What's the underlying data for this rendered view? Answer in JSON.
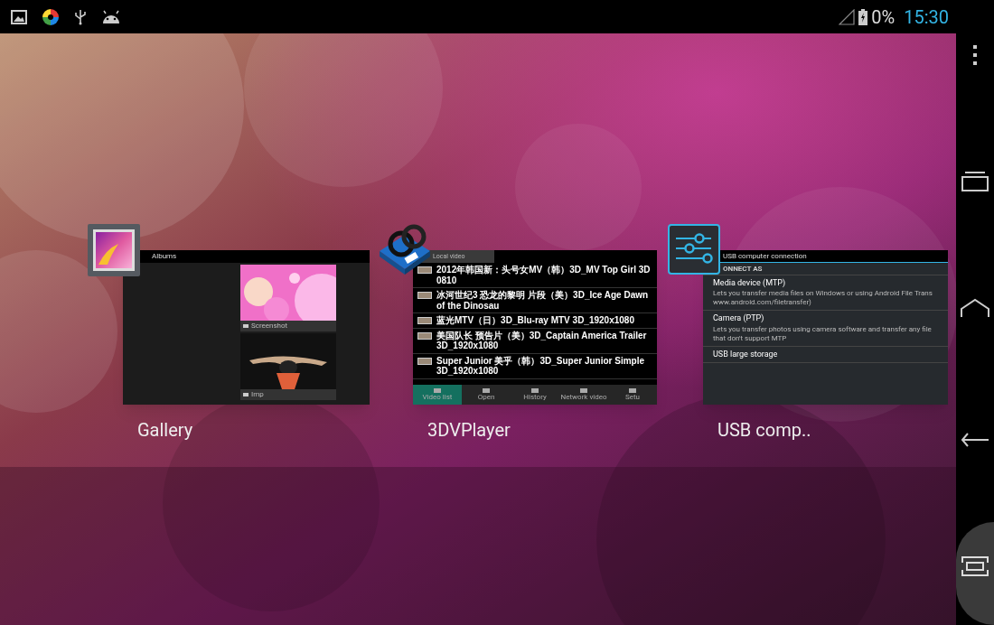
{
  "status_bar": {
    "battery": "0%",
    "time": "15:30"
  },
  "recent_apps": [
    {
      "kind": "gallery",
      "label": "Gallery",
      "thumbnail": {
        "title": "Albums",
        "albums": [
          {
            "name": "Screenshot",
            "kind": "pink"
          },
          {
            "name": "Imp",
            "kind": "dark"
          }
        ]
      }
    },
    {
      "kind": "video",
      "label": "3DVPlayer",
      "thumbnail": {
        "title": "Local video",
        "videos": [
          "2012年韩国新：头号女MV（韩）3D_MV Top Girl 3D 0810",
          "冰河世纪3 恐龙的黎明 片段（美）3D_Ice Age Dawn of the Dinosau",
          "蓝光MTV（日）3D_Blu-ray MTV 3D_1920x1080",
          "美国队长 预告片（美）3D_Captain America Trailer 3D_1920x1080",
          "Super Junior 美乎（韩）3D_Super Junior Simple 3D_1920x1080"
        ],
        "tabs": [
          {
            "label": "Video list",
            "selected": true
          },
          {
            "label": "Open",
            "selected": false
          },
          {
            "label": "History",
            "selected": false
          },
          {
            "label": "Network video",
            "selected": false
          },
          {
            "label": "Setu",
            "selected": false
          }
        ]
      }
    },
    {
      "kind": "settings",
      "label": "USB comp..",
      "thumbnail": {
        "title": "USB computer connection",
        "section": "ONNECT AS",
        "options": [
          {
            "title": "Media device (MTP)",
            "description": "Lets you transfer media files on Windows or using Android File Trans www.android.com/filetransfer)"
          },
          {
            "title": "Camera (PTP)",
            "description": "Lets you transfer photos using camera software and transfer any file that don't support MTP"
          },
          {
            "title": "USB large storage"
          }
        ]
      }
    }
  ]
}
